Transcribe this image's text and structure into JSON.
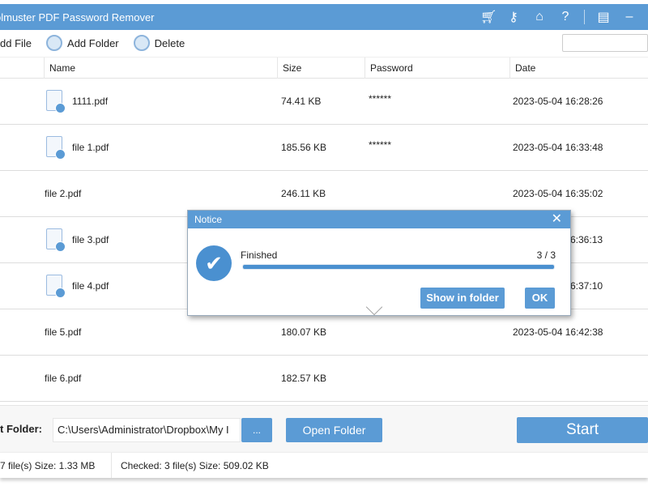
{
  "app": {
    "title": "olmuster PDF Password Remover",
    "icons": [
      "cart-icon",
      "key-icon",
      "home-icon",
      "help-icon",
      "feedback-icon",
      "minimize-icon"
    ]
  },
  "toolbar": {
    "add_file": "dd File",
    "add_folder": "Add Folder",
    "delete": "Delete",
    "search_value": ""
  },
  "columns": {
    "name": "Name",
    "size": "Size",
    "password": "Password",
    "date": "Date"
  },
  "rows": [
    {
      "name": "1111.pdf",
      "size": "74.41 KB",
      "password": "******",
      "date": "2023-05-04 16:28:26",
      "locked": true
    },
    {
      "name": "file 1.pdf",
      "size": "185.56 KB",
      "password": "******",
      "date": "2023-05-04 16:33:48",
      "locked": true
    },
    {
      "name": "file 2.pdf",
      "size": "246.11 KB",
      "password": "",
      "date": "2023-05-04 16:35:02",
      "locked": false
    },
    {
      "name": "file 3.pdf",
      "size": "",
      "password": "",
      "date": "6:36:13",
      "locked": true
    },
    {
      "name": "file 4.pdf",
      "size": "",
      "password": "",
      "date": "6:37:10",
      "locked": true
    },
    {
      "name": "file 5.pdf",
      "size": "180.07 KB",
      "password": "",
      "date": "2023-05-04 16:42:38",
      "locked": false
    },
    {
      "name": "file 6.pdf",
      "size": "182.57 KB",
      "password": "",
      "date": "",
      "locked": false
    }
  ],
  "output": {
    "label": "t Folder:",
    "path": "C:\\Users\\Administrator\\Dropbox\\My I",
    "browse": "...",
    "open_folder": "Open Folder",
    "start": "Start"
  },
  "status": {
    "total": "7 file(s) Size: 1.33 MB",
    "checked": "Checked: 3 file(s) Size: 509.02 KB"
  },
  "dialog": {
    "title": "Notice",
    "close": "✕",
    "status": "Finished",
    "count": "3 / 3",
    "progress": 1.0,
    "show_in_folder": "Show in folder",
    "ok": "OK"
  },
  "colors": {
    "accent": "#5b9bd5"
  }
}
